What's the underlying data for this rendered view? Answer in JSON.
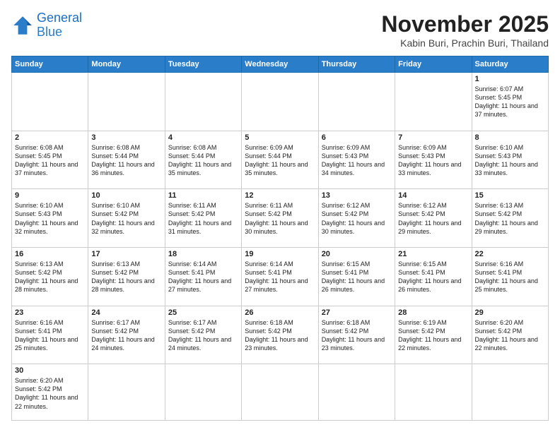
{
  "logo": {
    "line1": "General",
    "line2": "Blue"
  },
  "title": "November 2025",
  "location": "Kabin Buri, Prachin Buri, Thailand",
  "days_of_week": [
    "Sunday",
    "Monday",
    "Tuesday",
    "Wednesday",
    "Thursday",
    "Friday",
    "Saturday"
  ],
  "weeks": [
    [
      {
        "day": "",
        "info": ""
      },
      {
        "day": "",
        "info": ""
      },
      {
        "day": "",
        "info": ""
      },
      {
        "day": "",
        "info": ""
      },
      {
        "day": "",
        "info": ""
      },
      {
        "day": "",
        "info": ""
      },
      {
        "day": "1",
        "info": "Sunrise: 6:07 AM\nSunset: 5:45 PM\nDaylight: 11 hours\nand 37 minutes."
      }
    ],
    [
      {
        "day": "2",
        "info": "Sunrise: 6:08 AM\nSunset: 5:45 PM\nDaylight: 11 hours\nand 37 minutes."
      },
      {
        "day": "3",
        "info": "Sunrise: 6:08 AM\nSunset: 5:44 PM\nDaylight: 11 hours\nand 36 minutes."
      },
      {
        "day": "4",
        "info": "Sunrise: 6:08 AM\nSunset: 5:44 PM\nDaylight: 11 hours\nand 35 minutes."
      },
      {
        "day": "5",
        "info": "Sunrise: 6:09 AM\nSunset: 5:44 PM\nDaylight: 11 hours\nand 35 minutes."
      },
      {
        "day": "6",
        "info": "Sunrise: 6:09 AM\nSunset: 5:43 PM\nDaylight: 11 hours\nand 34 minutes."
      },
      {
        "day": "7",
        "info": "Sunrise: 6:09 AM\nSunset: 5:43 PM\nDaylight: 11 hours\nand 33 minutes."
      },
      {
        "day": "8",
        "info": "Sunrise: 6:10 AM\nSunset: 5:43 PM\nDaylight: 11 hours\nand 33 minutes."
      }
    ],
    [
      {
        "day": "9",
        "info": "Sunrise: 6:10 AM\nSunset: 5:43 PM\nDaylight: 11 hours\nand 32 minutes."
      },
      {
        "day": "10",
        "info": "Sunrise: 6:10 AM\nSunset: 5:42 PM\nDaylight: 11 hours\nand 32 minutes."
      },
      {
        "day": "11",
        "info": "Sunrise: 6:11 AM\nSunset: 5:42 PM\nDaylight: 11 hours\nand 31 minutes."
      },
      {
        "day": "12",
        "info": "Sunrise: 6:11 AM\nSunset: 5:42 PM\nDaylight: 11 hours\nand 30 minutes."
      },
      {
        "day": "13",
        "info": "Sunrise: 6:12 AM\nSunset: 5:42 PM\nDaylight: 11 hours\nand 30 minutes."
      },
      {
        "day": "14",
        "info": "Sunrise: 6:12 AM\nSunset: 5:42 PM\nDaylight: 11 hours\nand 29 minutes."
      },
      {
        "day": "15",
        "info": "Sunrise: 6:13 AM\nSunset: 5:42 PM\nDaylight: 11 hours\nand 29 minutes."
      }
    ],
    [
      {
        "day": "16",
        "info": "Sunrise: 6:13 AM\nSunset: 5:42 PM\nDaylight: 11 hours\nand 28 minutes."
      },
      {
        "day": "17",
        "info": "Sunrise: 6:13 AM\nSunset: 5:42 PM\nDaylight: 11 hours\nand 28 minutes."
      },
      {
        "day": "18",
        "info": "Sunrise: 6:14 AM\nSunset: 5:41 PM\nDaylight: 11 hours\nand 27 minutes."
      },
      {
        "day": "19",
        "info": "Sunrise: 6:14 AM\nSunset: 5:41 PM\nDaylight: 11 hours\nand 27 minutes."
      },
      {
        "day": "20",
        "info": "Sunrise: 6:15 AM\nSunset: 5:41 PM\nDaylight: 11 hours\nand 26 minutes."
      },
      {
        "day": "21",
        "info": "Sunrise: 6:15 AM\nSunset: 5:41 PM\nDaylight: 11 hours\nand 26 minutes."
      },
      {
        "day": "22",
        "info": "Sunrise: 6:16 AM\nSunset: 5:41 PM\nDaylight: 11 hours\nand 25 minutes."
      }
    ],
    [
      {
        "day": "23",
        "info": "Sunrise: 6:16 AM\nSunset: 5:41 PM\nDaylight: 11 hours\nand 25 minutes."
      },
      {
        "day": "24",
        "info": "Sunrise: 6:17 AM\nSunset: 5:42 PM\nDaylight: 11 hours\nand 24 minutes."
      },
      {
        "day": "25",
        "info": "Sunrise: 6:17 AM\nSunset: 5:42 PM\nDaylight: 11 hours\nand 24 minutes."
      },
      {
        "day": "26",
        "info": "Sunrise: 6:18 AM\nSunset: 5:42 PM\nDaylight: 11 hours\nand 23 minutes."
      },
      {
        "day": "27",
        "info": "Sunrise: 6:18 AM\nSunset: 5:42 PM\nDaylight: 11 hours\nand 23 minutes."
      },
      {
        "day": "28",
        "info": "Sunrise: 6:19 AM\nSunset: 5:42 PM\nDaylight: 11 hours\nand 22 minutes."
      },
      {
        "day": "29",
        "info": "Sunrise: 6:20 AM\nSunset: 5:42 PM\nDaylight: 11 hours\nand 22 minutes."
      }
    ],
    [
      {
        "day": "30",
        "info": "Sunrise: 6:20 AM\nSunset: 5:42 PM\nDaylight: 11 hours\nand 22 minutes."
      },
      {
        "day": "",
        "info": ""
      },
      {
        "day": "",
        "info": ""
      },
      {
        "day": "",
        "info": ""
      },
      {
        "day": "",
        "info": ""
      },
      {
        "day": "",
        "info": ""
      },
      {
        "day": "",
        "info": ""
      }
    ]
  ]
}
